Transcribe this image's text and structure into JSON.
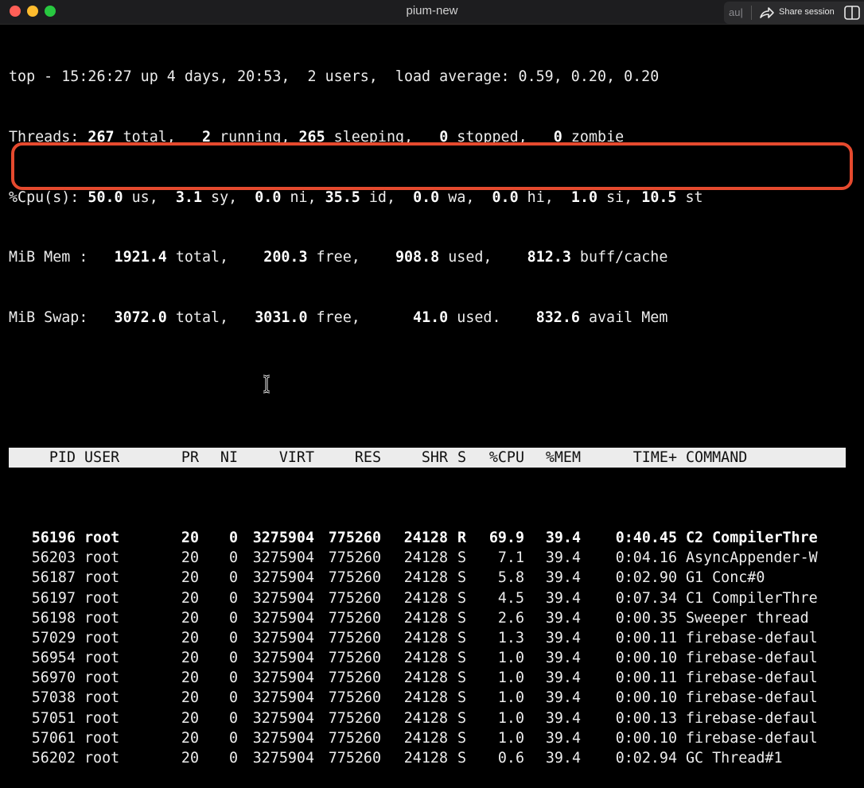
{
  "window": {
    "title": "pium-new",
    "share_prefix": "au|",
    "share_label": "Share session",
    "colors": {
      "close": "#ff5f57",
      "minimize": "#febc2e",
      "zoom": "#28c840",
      "highlight": "#e64a2e"
    }
  },
  "summary": {
    "l1": "top - 15:26:27 up 4 days, 20:53,  2 users,  load average: 0.59, 0.20, 0.20",
    "threads": {
      "p1": "Threads: ",
      "total": "267",
      "p2": " total,   ",
      "running": "2",
      "p3": " running, ",
      "sleeping": "265",
      "p4": " sleeping,   ",
      "stopped": "0",
      "p5": " stopped,   ",
      "zombie": "0",
      "p6": " zombie"
    },
    "cpu": {
      "p1": "%Cpu(s): ",
      "us": "50.0",
      "p2": " us,  ",
      "sy": "3.1",
      "p3": " sy,  ",
      "ni": "0.0",
      "p4": " ni, ",
      "id": "35.5",
      "p5": " id,  ",
      "wa": "0.0",
      "p6": " wa,  ",
      "hi": "0.0",
      "p7": " hi,  ",
      "si": "1.0",
      "p8": " si, ",
      "st": "10.5",
      "p9": " st"
    },
    "mem": {
      "p1": "MiB Mem :   ",
      "total": "1921.4",
      "p2": " total,    ",
      "free": "200.3",
      "p3": " free,    ",
      "used": "908.8",
      "p4": " used,    ",
      "buff": "812.3",
      "p5": " buff/cache"
    },
    "swap": {
      "p1": "MiB Swap:   ",
      "total": "3072.0",
      "p2": " total,   ",
      "free": "3031.0",
      "p3": " free,      ",
      "used": "41.0",
      "p4": " used.    ",
      "avail": "832.6",
      "p5": " avail Mem"
    }
  },
  "table": {
    "headers": {
      "pid": "PID",
      "user": "USER",
      "pr": "PR",
      "ni": "NI",
      "virt": "VIRT",
      "res": "RES",
      "shr": "SHR",
      "s": "S",
      "cpu": "%CPU",
      "mem": "%MEM",
      "time": "TIME+",
      "cmd": "COMMAND"
    },
    "rows": [
      {
        "pid": "56196",
        "user": "root",
        "pr": "20",
        "ni": "0",
        "virt": "3275904",
        "res": "775260",
        "shr": "24128",
        "s": "R",
        "cpu": "69.9",
        "mem": "39.4",
        "time": "0:40.45",
        "cmd": "C2 CompilerThre"
      },
      {
        "pid": "56203",
        "user": "root",
        "pr": "20",
        "ni": "0",
        "virt": "3275904",
        "res": "775260",
        "shr": "24128",
        "s": "S",
        "cpu": "7.1",
        "mem": "39.4",
        "time": "0:04.16",
        "cmd": "AsyncAppender-W"
      },
      {
        "pid": "56187",
        "user": "root",
        "pr": "20",
        "ni": "0",
        "virt": "3275904",
        "res": "775260",
        "shr": "24128",
        "s": "S",
        "cpu": "5.8",
        "mem": "39.4",
        "time": "0:02.90",
        "cmd": "G1 Conc#0"
      },
      {
        "pid": "56197",
        "user": "root",
        "pr": "20",
        "ni": "0",
        "virt": "3275904",
        "res": "775260",
        "shr": "24128",
        "s": "S",
        "cpu": "4.5",
        "mem": "39.4",
        "time": "0:07.34",
        "cmd": "C1 CompilerThre"
      },
      {
        "pid": "56198",
        "user": "root",
        "pr": "20",
        "ni": "0",
        "virt": "3275904",
        "res": "775260",
        "shr": "24128",
        "s": "S",
        "cpu": "2.6",
        "mem": "39.4",
        "time": "0:00.35",
        "cmd": "Sweeper thread"
      },
      {
        "pid": "57029",
        "user": "root",
        "pr": "20",
        "ni": "0",
        "virt": "3275904",
        "res": "775260",
        "shr": "24128",
        "s": "S",
        "cpu": "1.3",
        "mem": "39.4",
        "time": "0:00.11",
        "cmd": "firebase-defaul"
      },
      {
        "pid": "56954",
        "user": "root",
        "pr": "20",
        "ni": "0",
        "virt": "3275904",
        "res": "775260",
        "shr": "24128",
        "s": "S",
        "cpu": "1.0",
        "mem": "39.4",
        "time": "0:00.10",
        "cmd": "firebase-defaul"
      },
      {
        "pid": "56970",
        "user": "root",
        "pr": "20",
        "ni": "0",
        "virt": "3275904",
        "res": "775260",
        "shr": "24128",
        "s": "S",
        "cpu": "1.0",
        "mem": "39.4",
        "time": "0:00.11",
        "cmd": "firebase-defaul"
      },
      {
        "pid": "57038",
        "user": "root",
        "pr": "20",
        "ni": "0",
        "virt": "3275904",
        "res": "775260",
        "shr": "24128",
        "s": "S",
        "cpu": "1.0",
        "mem": "39.4",
        "time": "0:00.10",
        "cmd": "firebase-defaul"
      },
      {
        "pid": "57051",
        "user": "root",
        "pr": "20",
        "ni": "0",
        "virt": "3275904",
        "res": "775260",
        "shr": "24128",
        "s": "S",
        "cpu": "1.0",
        "mem": "39.4",
        "time": "0:00.13",
        "cmd": "firebase-defaul"
      },
      {
        "pid": "57061",
        "user": "root",
        "pr": "20",
        "ni": "0",
        "virt": "3275904",
        "res": "775260",
        "shr": "24128",
        "s": "S",
        "cpu": "1.0",
        "mem": "39.4",
        "time": "0:00.10",
        "cmd": "firebase-defaul"
      },
      {
        "pid": "56202",
        "user": "root",
        "pr": "20",
        "ni": "0",
        "virt": "3275904",
        "res": "775260",
        "shr": "24128",
        "s": "S",
        "cpu": "0.6",
        "mem": "39.4",
        "time": "0:02.94",
        "cmd": "GC Thread#1"
      }
    ]
  }
}
